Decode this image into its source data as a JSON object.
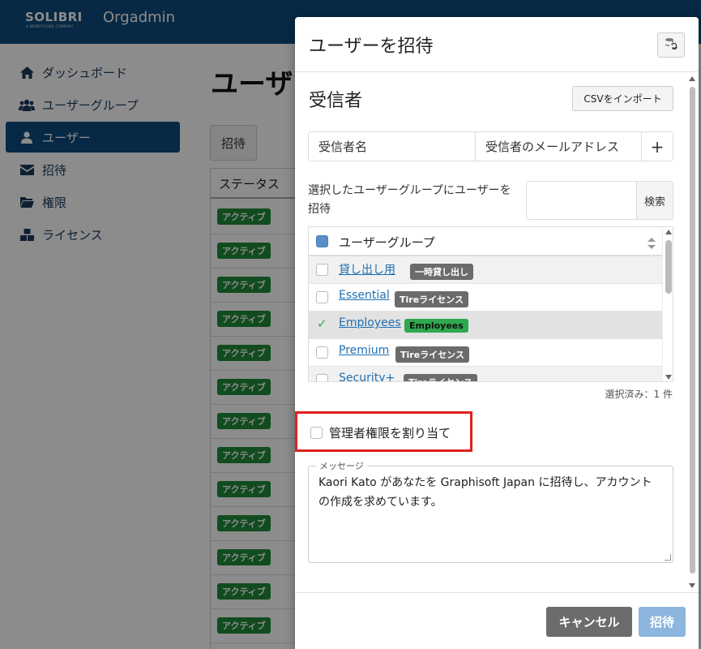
{
  "app": {
    "logo_text": "SOLIBRI",
    "logo_subtext": "A NEMETSCHEK COMPANY",
    "app_name": "Orgadmin"
  },
  "sidebar": {
    "items": [
      {
        "label": "ダッシュボード",
        "icon": "home-icon"
      },
      {
        "label": "ユーザーグループ",
        "icon": "users-icon"
      },
      {
        "label": "ユーザー",
        "icon": "user-icon",
        "active": true
      },
      {
        "label": "招待",
        "icon": "envelope-icon"
      },
      {
        "label": "権限",
        "icon": "folder-icon"
      },
      {
        "label": "ライセンス",
        "icon": "boxes-icon"
      }
    ]
  },
  "main": {
    "page_title": "ユーザー",
    "tab_invite": "招待",
    "table_header_status": "ステータス",
    "status_rows": [
      "アクティブ",
      "アクティブ",
      "アクティブ",
      "アクティブ",
      "アクティブ",
      "アクティブ",
      "アクティブ",
      "アクティブ",
      "アクティブ",
      "アクティブ",
      "アクティブ",
      "アクティブ",
      "アクティブ"
    ]
  },
  "modal": {
    "title": "ユーザーを招待",
    "refresh_icon": "database-refresh-icon",
    "recipients_title": "受信者",
    "csv_import_label": "CSVをインポート",
    "recipient_name_placeholder": "受信者名",
    "recipient_email_placeholder": "受信者のメールアドレス",
    "add_label": "+",
    "group_select_label": "選択したユーザーグループにユーザーを招待",
    "search_label": "検索",
    "group_table": {
      "header": "ユーザーグループ",
      "rows": [
        {
          "name": "貸し出し用",
          "badge": "一時貸し出し",
          "badge_color": "#6b6b6b",
          "selected": false
        },
        {
          "name": "Essential",
          "badge": "Tireライセンス",
          "badge_color": "#6b6b6b",
          "selected": false
        },
        {
          "name": "Employees",
          "badge": "Employees",
          "badge_color": "#2fa84f",
          "selected": true
        },
        {
          "name": "Premium",
          "badge": "Tireライセンス",
          "badge_color": "#6b6b6b",
          "selected": false
        },
        {
          "name": "Security+",
          "badge": "Tireライセンス",
          "badge_color": "#6b6b6b",
          "selected": false
        }
      ]
    },
    "selected_count": "選択済み：1 件",
    "assign_admin_label": "管理者権限を割り当て",
    "message_legend": "メッセージ",
    "message_text": "Kaori Kato があなたを Graphisoft Japan に招待し、アカウントの作成を求めています。",
    "cancel_label": "キャンセル",
    "submit_label": "招待"
  },
  "colors": {
    "brand": "#0e4c7e",
    "active_badge": "#1f8a3a",
    "highlight_border": "#e02020",
    "submit_button": "#8db6de",
    "cancel_button": "#6c6c6c"
  }
}
